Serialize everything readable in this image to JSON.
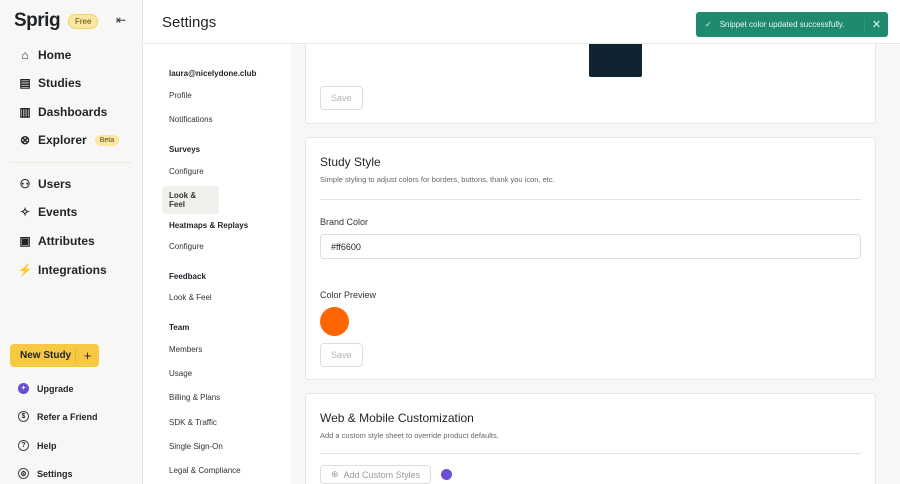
{
  "sidebar": {
    "logo": "Sprig",
    "plan_badge": "Free",
    "collapse_icon": "⇤",
    "primary": [
      {
        "label": "Home",
        "icon": "⌂"
      },
      {
        "label": "Studies",
        "icon": "▤"
      },
      {
        "label": "Dashboards",
        "icon": "▥"
      },
      {
        "label": "Explorer",
        "icon": "⊗",
        "badge": "Beta"
      }
    ],
    "secondary": [
      {
        "label": "Users",
        "icon": "⚇"
      },
      {
        "label": "Events",
        "icon": "✧"
      },
      {
        "label": "Attributes",
        "icon": "▣"
      },
      {
        "label": "Integrations",
        "icon": "⚡"
      }
    ],
    "new_study": "New Study",
    "new_study_plus": "+",
    "bottom": [
      {
        "label": "Upgrade",
        "icon": "+"
      },
      {
        "label": "Refer a Friend",
        "icon": "$"
      },
      {
        "label": "Help",
        "icon": "?"
      },
      {
        "label": "Settings",
        "icon": "⚙"
      }
    ]
  },
  "header": {
    "title": "Settings"
  },
  "settings_nav": {
    "account": "laura@nicelydone.club",
    "account_items": [
      "Profile",
      "Notifications"
    ],
    "surveys": "Surveys",
    "surveys_items": [
      "Configure",
      "Look & Feel"
    ],
    "heatmaps": "Heatmaps & Replays",
    "heatmaps_items": [
      "Configure"
    ],
    "feedback": "Feedback",
    "feedback_items": [
      "Look & Feel"
    ],
    "team": "Team",
    "team_items": [
      "Members",
      "Usage",
      "Billing & Plans",
      "SDK & Traffic",
      "Single Sign-On",
      "Legal & Compliance"
    ]
  },
  "snippet_card": {
    "swatch_color": "#0f2430",
    "save": "Save"
  },
  "study_style": {
    "title": "Study Style",
    "subtitle": "Simple styling to adjust colors for borders, buttons, thank you icon, etc.",
    "brand_label": "Brand Color",
    "brand_value": "#ff6600",
    "preview_label": "Color Preview",
    "preview_color": "#ff6600",
    "save": "Save"
  },
  "web_mobile": {
    "title": "Web & Mobile Customization",
    "subtitle": "Add a custom style sheet to override product defaults.",
    "add_button": "Add Custom Styles"
  },
  "toast": {
    "message": "Snippet color updated successfully.",
    "close": "✕",
    "check": "✓"
  }
}
